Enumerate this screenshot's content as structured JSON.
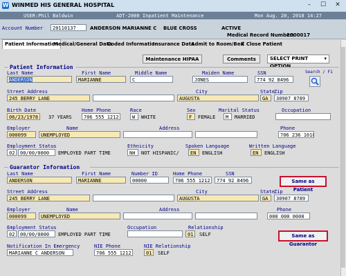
{
  "window": {
    "title": "WINMED HIS GENERAL HOSPITAL",
    "minimize": "–",
    "maximize": "☐",
    "close": "✕"
  },
  "header": {
    "user": "USER:Phil Baldwin",
    "module": "ADT-2000   Inpatient Maintenance",
    "datetime": "Mon Aug. 20, 2018 14:27",
    "account_label": "Account Number",
    "account_number": "20110137",
    "patient_name": "ANDERSON MARIANNE C",
    "insurance": "BLUE CROSS",
    "status": "ACTIVE",
    "mrn_label": "Medical Record Number:",
    "mrn": "2000017"
  },
  "tabs": [
    "Patient Information",
    "Medical/General Data",
    "Coded Information",
    "Insurance Data",
    "Admit to Room/Bed",
    "X Close Patient"
  ],
  "toolbar": {
    "maintenance": "Maintenance HIPAA",
    "comments": "Comments",
    "print_select": "SELECT PRINT OPTION"
  },
  "patient": {
    "section": "Patient Information",
    "last_name_label": "Last Name",
    "last_name": "ANDERSON",
    "first_name_label": "First Name",
    "first_name": "MARIANNE",
    "middle_name_label": "Middle Name",
    "middle_name": "C",
    "maiden_name_label": "Maiden Name",
    "maiden_name": "JONES",
    "ssn_label": "SSN",
    "ssn": "774 92 8496",
    "search_label": "Search / F1",
    "street_label": "Street Address",
    "street": "245 BERRY LANE",
    "city_label": "City",
    "city": "AUGUSTA",
    "state_label": "State",
    "state": "GA",
    "zip_label": "Zip",
    "zip": "30907 8789",
    "birth_label": "Birth Date",
    "birth_date": "06/23/1978",
    "age": "37 YEARS",
    "home_phone_label": "Home Phone",
    "home_phone": "706 555 1212",
    "race_label": "Race",
    "race_code": "W",
    "race": "WHITE",
    "sex_label": "Sex",
    "sex_code": "F",
    "sex": "FEMALE",
    "marital_label": "Marital Status",
    "marital_code": "M",
    "marital": "MARRIED",
    "occupation_label": "Occupation",
    "occupation": "",
    "employer_label": "Employer",
    "employer_code": "000099",
    "emp_name_label": "Name",
    "employer_name": "UNEMPLOYED",
    "emp_address_label": "Address",
    "employer_address": "",
    "emp_phone_label": "Phone",
    "employer_phone": "706 236 1010",
    "emp_status_label": "Employment Status",
    "emp_status_code": "02",
    "emp_status_date": "00/00/0000",
    "emp_status": "EMPLOYED PART TIME",
    "ethnicity_label": "Ethnicity",
    "ethnicity_code": "NH",
    "ethnicity": "NOT HISPANIC/",
    "spoken_label": "Spoken Language",
    "spoken_code": "EN",
    "spoken": "ENGLISH",
    "written_label": "Written Language",
    "written_code": "EN",
    "written": "ENGLISH"
  },
  "guarantor": {
    "section": "Guarantor Information",
    "last_name_label": "Last Name",
    "last_name": "ANDERSON",
    "first_name_label": "First Name",
    "first_name": "MARIANNE",
    "number_id_label": "Number ID",
    "number_id": "00000",
    "home_phone_label": "Home Phone",
    "home_phone": "706 555 1212",
    "ssn_label": "SSN",
    "ssn": "774 92 8496",
    "same_as_patient": "Same as Patient",
    "street_label": "Street Address",
    "street": "245 BERRY LANE",
    "city_label": "City",
    "city": "AUGUSTA",
    "state_label": "State",
    "state": "GA",
    "zip_label": "Zip",
    "zip": "30907 8789",
    "employer_label": "Employer",
    "employer_code": "000099",
    "emp_name_label": "Name",
    "employer_name": "UNEMPLOYED",
    "emp_address_label": "Address",
    "employer_address": "",
    "emp_phone_label": "Phone",
    "employer_phone": "000 000 0000",
    "emp_status_label": "Employment Status",
    "emp_status_code": "02",
    "emp_status_date": "00/00/0000",
    "emp_status": "EMPLOYED PART TIME",
    "occupation_label": "Occupation",
    "occupation": "",
    "relationship_label": "Relationship",
    "relationship_code": "01",
    "relationship": "SELF",
    "same_as_guarantor": "Same as Guarantor",
    "emergency_label": "Notification In Emergency",
    "emergency": "MARIANNE C ANDERSON",
    "nie_phone_label": "NIE Phone",
    "nie_phone": "706 555 1212",
    "nie_rel_label": "NIE Relationship",
    "nie_rel_code": "01",
    "nie_rel": "SELF"
  }
}
